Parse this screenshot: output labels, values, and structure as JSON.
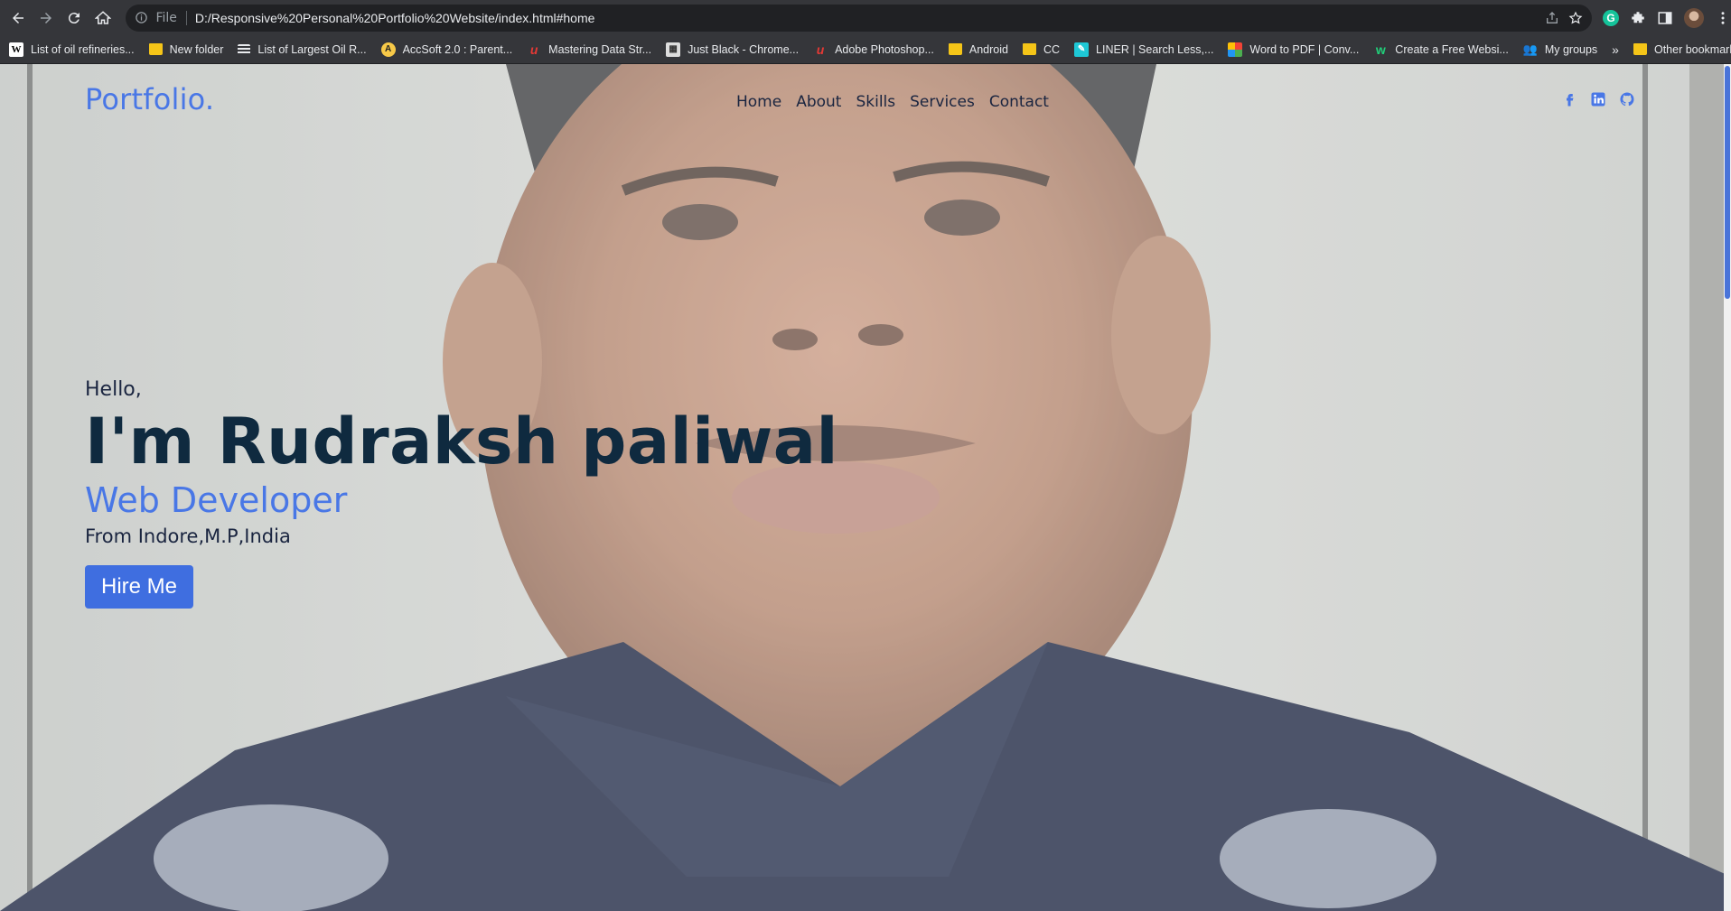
{
  "browser": {
    "url_scheme": "File",
    "url": "D:/Responsive%20Personal%20Portfolio%20Website/index.html#home",
    "grammarly_letter": "G",
    "bookmarks": [
      {
        "label": "List of oil refineries...",
        "icon": "wiki"
      },
      {
        "label": "New folder",
        "icon": "folder"
      },
      {
        "label": "List of Largest Oil R...",
        "icon": "list"
      },
      {
        "label": "AccSoft 2.0 : Parent...",
        "icon": "acc"
      },
      {
        "label": "Mastering Data Str...",
        "icon": "red"
      },
      {
        "label": "Just Black - Chrome...",
        "icon": "grey"
      },
      {
        "label": "Adobe Photoshop...",
        "icon": "red"
      },
      {
        "label": "Android",
        "icon": "folder"
      },
      {
        "label": "CC",
        "icon": "folder"
      },
      {
        "label": "LINER | Search Less,...",
        "icon": "liner"
      },
      {
        "label": "Word to PDF | Conv...",
        "icon": "w2p"
      },
      {
        "label": "Create a Free Websi...",
        "icon": "wix"
      },
      {
        "label": "My groups",
        "icon": "groups"
      }
    ],
    "more_label": "»",
    "other_bookmarks": "Other bookmarks"
  },
  "site": {
    "logo": "Portfolio.",
    "nav": [
      "Home",
      "About",
      "Skills",
      "Services",
      "Contact"
    ],
    "social_icons": [
      "facebook-icon",
      "linkedin-icon",
      "github-icon"
    ],
    "hero": {
      "greeting": "Hello,",
      "name": "I'm Rudraksh paliwal",
      "role": "Web Developer",
      "location": "From Indore,M.P,India",
      "cta": "Hire Me"
    }
  },
  "colors": {
    "brand": "#4977e6",
    "heading": "#0f2a3f",
    "button": "#3f6ee0",
    "chrome": "#35363a"
  }
}
